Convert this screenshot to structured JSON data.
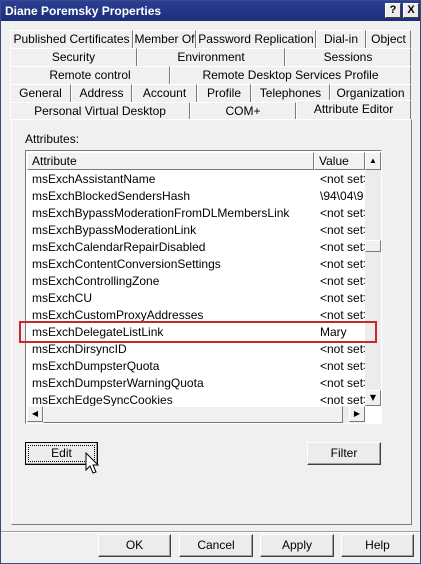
{
  "window": {
    "title": "Diane Poremsky Properties",
    "help_btn": "?",
    "close_btn": "X"
  },
  "tabs": {
    "row1": [
      "Published Certificates",
      "Member Of",
      "Password Replication",
      "Dial-in",
      "Object"
    ],
    "row2": [
      "Security",
      "Environment",
      "Sessions"
    ],
    "row3": [
      "Remote control",
      "Remote Desktop Services Profile"
    ],
    "row4": [
      "General",
      "Address",
      "Account",
      "Profile",
      "Telephones",
      "Organization"
    ],
    "row5": [
      "Personal Virtual Desktop",
      "COM+",
      "Attribute Editor"
    ]
  },
  "attributes": {
    "label": "Attributes:",
    "columns": [
      "Attribute",
      "Value"
    ],
    "rows": [
      {
        "name": "msExchAssistantName",
        "value": "<not set>"
      },
      {
        "name": "msExchBlockedSendersHash",
        "value": "\\94\\04\\9"
      },
      {
        "name": "msExchBypassModerationFromDLMembersLink",
        "value": "<not set>"
      },
      {
        "name": "msExchBypassModerationLink",
        "value": "<not set>"
      },
      {
        "name": "msExchCalendarRepairDisabled",
        "value": "<not set>"
      },
      {
        "name": "msExchContentConversionSettings",
        "value": "<not set>"
      },
      {
        "name": "msExchControllingZone",
        "value": "<not set>"
      },
      {
        "name": "msExchCU",
        "value": "<not set>"
      },
      {
        "name": "msExchCustomProxyAddresses",
        "value": "<not set>"
      },
      {
        "name": "msExchDelegateListLink",
        "value": "Mary"
      },
      {
        "name": "msExchDirsyncID",
        "value": "<not set>"
      },
      {
        "name": "msExchDumpsterQuota",
        "value": "<not set>"
      },
      {
        "name": "msExchDumpsterWarningQuota",
        "value": "<not set>"
      },
      {
        "name": "msExchEdgeSyncCookies",
        "value": "<not set>"
      }
    ]
  },
  "buttons": {
    "edit": "Edit",
    "filter": "Filter",
    "ok": "OK",
    "cancel": "Cancel",
    "apply": "Apply",
    "help": "Help"
  },
  "colors": {
    "highlight_border": "#c8282d",
    "titlebar": "#1c2d78"
  }
}
